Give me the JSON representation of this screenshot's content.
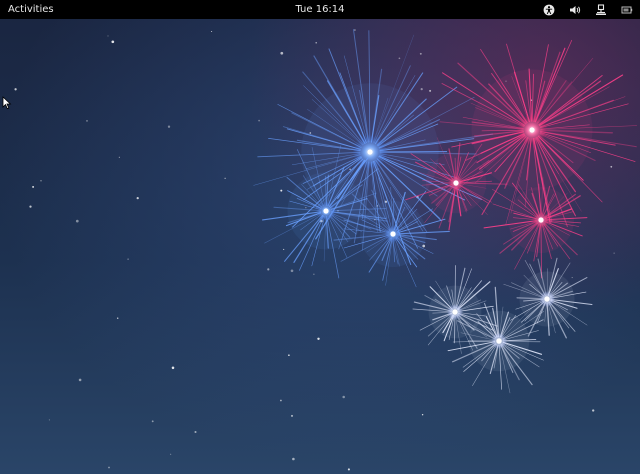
{
  "topbar": {
    "activities_label": "Activities",
    "clock_text": "Tue 16:14",
    "tray_icons": [
      "accessibility-icon",
      "volume-icon",
      "network-icon",
      "battery-icon"
    ]
  },
  "wallpaper": {
    "colors": {
      "background_top": "#1a2540",
      "background_bottom": "#2a4568",
      "firework_blue": "#6aa0ff",
      "firework_pink": "#ff3f8a",
      "firework_white": "#e6ecff"
    }
  }
}
